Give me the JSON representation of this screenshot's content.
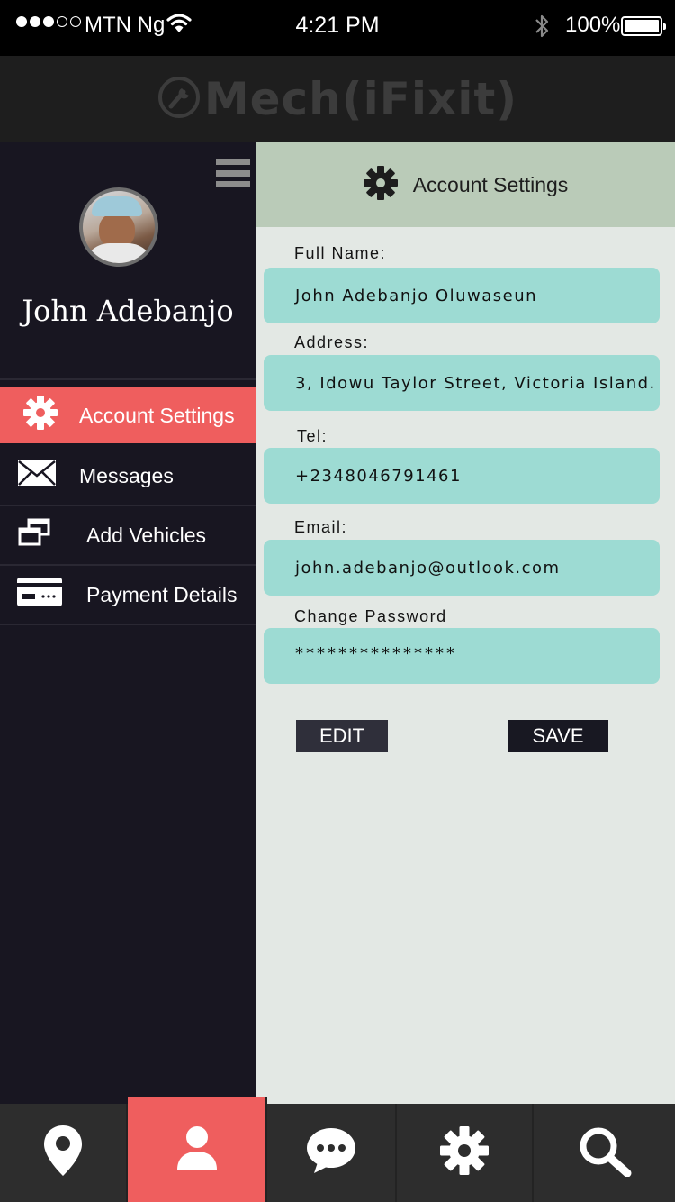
{
  "status_bar": {
    "carrier": "MTN Ng",
    "time": "4:21 PM",
    "battery": "100%",
    "signal_bars_filled": 3,
    "signal_bars_total": 5
  },
  "app": {
    "logo_text": "Mech(iFixit)",
    "logo_icon": "wrench-icon"
  },
  "sidebar": {
    "user_name": "John Adebanjo",
    "menu_icon": "hamburger-icon",
    "items": [
      {
        "label": "Account Settings",
        "icon": "gear-icon",
        "active": true
      },
      {
        "label": "Messages",
        "icon": "envelope-icon",
        "active": false
      },
      {
        "label": "Add Vehicles",
        "icon": "windows-icon",
        "active": false
      },
      {
        "label": "Payment Details",
        "icon": "card-icon",
        "active": false
      }
    ]
  },
  "content": {
    "title": "Account Settings",
    "fields": {
      "full_name": {
        "label": "Full Name:",
        "value": "John Adebanjo Oluwaseun"
      },
      "address": {
        "label": "Address:",
        "value": "3, Idowu Taylor Street, Victoria Island."
      },
      "tel": {
        "label": "Tel:",
        "value": "+2348046791461"
      },
      "email": {
        "label": "Email:",
        "value": "john.adebanjo@outlook.com"
      },
      "password": {
        "label": "Change Password",
        "value": "***************"
      }
    },
    "edit_label": "EDIT",
    "save_label": "SAVE"
  },
  "tabbar": {
    "tabs": [
      {
        "icon": "location-pin-icon",
        "active": false
      },
      {
        "icon": "profile-icon",
        "active": true
      },
      {
        "icon": "chat-icon",
        "active": false
      },
      {
        "icon": "settings-icon",
        "active": false
      },
      {
        "icon": "search-icon",
        "active": false
      }
    ]
  },
  "colors": {
    "accent": "#ef5e5e",
    "sidebar_bg": "#181621",
    "field_bg": "#9ddbd3",
    "content_header_bg": "#bacbb8",
    "content_bg": "#e3e8e4"
  }
}
